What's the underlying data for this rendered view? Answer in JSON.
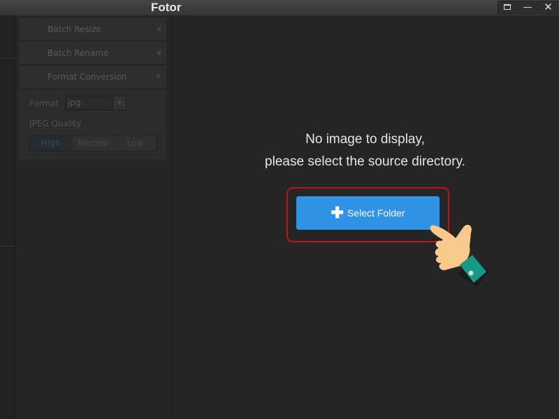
{
  "window": {
    "title": "Fotor",
    "controls": [
      "restore-icon",
      "minimize-icon",
      "close-icon"
    ]
  },
  "panel": {
    "sections": [
      {
        "label": "Batch Resize",
        "state": "collapsed"
      },
      {
        "label": "Batch Rename",
        "state": "collapsed"
      },
      {
        "label": "Format Conversion",
        "state": "expanded"
      }
    ],
    "format_label": "Format",
    "format_value": "jpg",
    "quality_label": "JPEG Quality",
    "quality_options": [
      "High",
      "Normal",
      "Low"
    ],
    "quality_selected": "High"
  },
  "main": {
    "message_line1": "No image to display,",
    "message_line2": "please select the source directory.",
    "select_button": "Select Folder",
    "accent_color": "#3193e6",
    "highlight_color": "#c0141b"
  }
}
